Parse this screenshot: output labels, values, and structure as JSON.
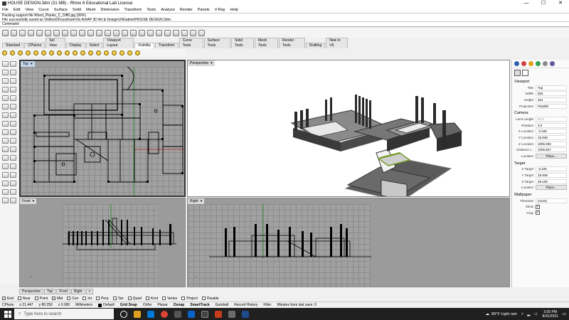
{
  "window": {
    "title": "HOUSE DESIGN.3dm (31 MB) - Rhino 6 Educational Lab License",
    "buttons": [
      "—",
      "☐",
      "✕"
    ]
  },
  "menu": [
    "File",
    "Edit",
    "View",
    "Curve",
    "Surface",
    "Solid",
    "Mesh",
    "Dimension",
    "Transform",
    "Tools",
    "Analyze",
    "Render",
    "Panels",
    "V-Ray",
    "Help"
  ],
  "history": [
    "Packing support file Wood_Planks_C_Diff0.jpg (99%)",
    "File successfully saved as \\\\fsfiles03\\nusshare\\Vis Art\\AP 3D Art & Design\\24Gabriel\\HOUSE DESIGN.3dm."
  ],
  "command": {
    "label": "Command:"
  },
  "tabs": {
    "items": [
      "Standard",
      "CPlanes",
      "Set View",
      "Display",
      "Select",
      "Viewport Layout",
      "Visibility",
      "Transform",
      "Curve Tools",
      "Surface Tools",
      "Solid Tools",
      "Mesh Tools",
      "Render Tools",
      "Drafting",
      "New in V6"
    ],
    "active": "Visibility"
  },
  "viewports": {
    "top": "Top",
    "perspective": "Perspective",
    "front": "Front",
    "right": "Right"
  },
  "viewport_tabs": [
    "Perspective",
    "Top",
    "Front",
    "Right",
    "+"
  ],
  "properties": {
    "viewport_section": "Viewport",
    "viewport": [
      {
        "label": "Title",
        "value": "Top"
      },
      {
        "label": "Width",
        "value": "562"
      },
      {
        "label": "Height",
        "value": "461"
      },
      {
        "label": "Projection",
        "value": "Parallel"
      }
    ],
    "camera_section": "Camera",
    "camera": [
      {
        "label": "Lens Length",
        "value": "50.0"
      },
      {
        "label": "Rotation",
        "value": "0.0"
      },
      {
        "label": "X Location",
        "value": "-3.105"
      },
      {
        "label": "Y Location",
        "value": "19.948"
      },
      {
        "label": "Z Location",
        "value": "1055.935"
      },
      {
        "label": "Distance t...",
        "value": "1006.827"
      },
      {
        "label": "Location",
        "value": "Place..."
      }
    ],
    "target_section": "Target",
    "target": [
      {
        "label": "X Target",
        "value": "-3.105"
      },
      {
        "label": "Y Target",
        "value": "19.948"
      },
      {
        "label": "Z Target",
        "value": "49.109"
      },
      {
        "label": "Location",
        "value": "Place..."
      }
    ],
    "wallpaper_section": "Wallpaper",
    "wallpaper": [
      {
        "label": "Filename",
        "value": "(none)"
      },
      {
        "label": "Show",
        "value": "✓"
      },
      {
        "label": "Gray",
        "value": "✓"
      }
    ]
  },
  "osnaps": [
    {
      "label": "End",
      "checked": true
    },
    {
      "label": "Near",
      "checked": false
    },
    {
      "label": "Point",
      "checked": false
    },
    {
      "label": "Mid",
      "checked": true
    },
    {
      "label": "Cen",
      "checked": false
    },
    {
      "label": "Int",
      "checked": false
    },
    {
      "label": "Perp",
      "checked": false
    },
    {
      "label": "Tan",
      "checked": false
    },
    {
      "label": "Quad",
      "checked": false
    },
    {
      "label": "Knot",
      "checked": false
    },
    {
      "label": "Vertex",
      "checked": false
    },
    {
      "label": "Project",
      "checked": false
    },
    {
      "label": "Disable",
      "checked": false
    }
  ],
  "status": {
    "cplane": "CPlane",
    "x": "x 21.447",
    "y": "y 80.250",
    "z": "z 0.000",
    "units": "Millimeters",
    "layer": "Default",
    "grid_snap": "Grid Snap",
    "ortho": "Ortho",
    "planar": "Planar",
    "osnap": "Osnap",
    "smarttrack": "SmartTrack",
    "gumball": "Gumball",
    "record": "Record History",
    "filter": "Filter",
    "info": "Minutes from last save: 0"
  },
  "taskbar": {
    "search_placeholder": "Type here to search",
    "weather": "89°F  Light rain",
    "time": "3:35 PM",
    "date": "8/31/2021"
  },
  "colors": {
    "accent": "#0078d7",
    "active_vp": "#c7d8ee",
    "taskbar": "#202020"
  }
}
